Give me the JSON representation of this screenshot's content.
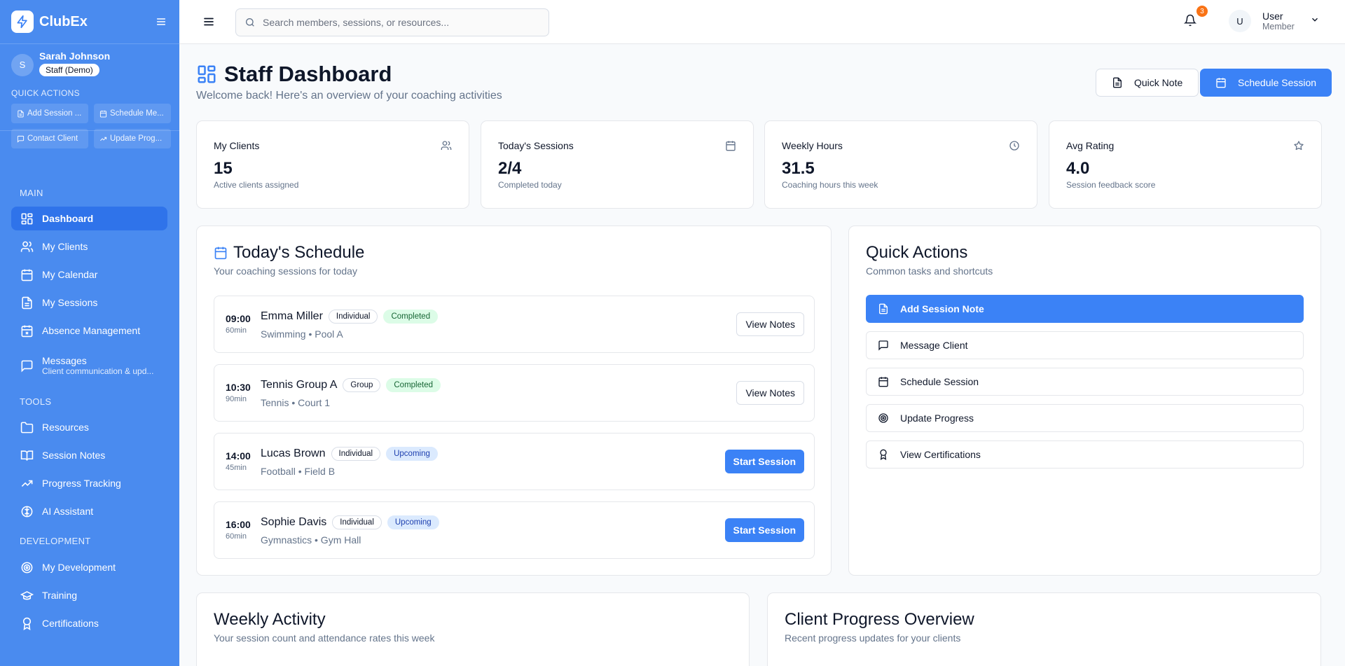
{
  "app": {
    "name": "ClubEx"
  },
  "sidebar": {
    "user": {
      "initial": "S",
      "name": "Sarah Johnson",
      "role": "Staff (Demo)"
    },
    "quick_actions_title": "QUICK ACTIONS",
    "quick_actions": [
      {
        "label": "Add Session ...",
        "icon": "note-icon"
      },
      {
        "label": "Schedule Me...",
        "icon": "calendar-icon"
      },
      {
        "label": "Contact Client",
        "icon": "message-icon"
      },
      {
        "label": "Update Prog...",
        "icon": "trend-icon"
      }
    ],
    "sections": {
      "main": "MAIN",
      "tools": "TOOLS",
      "development": "DEVELOPMENT"
    },
    "items": {
      "dashboard": "Dashboard",
      "my_clients": "My Clients",
      "my_calendar": "My Calendar",
      "my_sessions": "My Sessions",
      "absence_management": "Absence Management",
      "messages": "Messages",
      "messages_sub": "Client communication & upd...",
      "resources": "Resources",
      "session_notes": "Session Notes",
      "progress_tracking": "Progress Tracking",
      "ai_assistant": "AI Assistant",
      "my_development": "My Development",
      "training": "Training",
      "certifications": "Certifications"
    }
  },
  "topbar": {
    "search_placeholder": "Search members, sessions, or resources...",
    "notification_count": "3",
    "user": {
      "initial": "U",
      "name": "User",
      "role": "Member"
    }
  },
  "header": {
    "title": "Staff Dashboard",
    "subtitle": "Welcome back! Here's an overview of your coaching activities",
    "quick_note_label": "Quick Note",
    "schedule_session_label": "Schedule Session"
  },
  "stats": [
    {
      "label": "My Clients",
      "value": "15",
      "sub": "Active clients assigned",
      "icon": "users-icon"
    },
    {
      "label": "Today's Sessions",
      "value": "2/4",
      "sub": "Completed today",
      "icon": "calendar-icon"
    },
    {
      "label": "Weekly Hours",
      "value": "31.5",
      "sub": "Coaching hours this week",
      "icon": "clock-icon"
    },
    {
      "label": "Avg Rating",
      "value": "4.0",
      "sub": "Session feedback score",
      "icon": "star-icon"
    }
  ],
  "schedule": {
    "title": "Today's Schedule",
    "subtitle": "Your coaching sessions for today",
    "sessions": [
      {
        "time": "09:00",
        "duration": "60min",
        "name": "Emma Miller",
        "type": "Individual",
        "status": "Completed",
        "location": "Swimming • Pool A",
        "action": "View Notes"
      },
      {
        "time": "10:30",
        "duration": "90min",
        "name": "Tennis Group A",
        "type": "Group",
        "status": "Completed",
        "location": "Tennis • Court 1",
        "action": "View Notes"
      },
      {
        "time": "14:00",
        "duration": "45min",
        "name": "Lucas Brown",
        "type": "Individual",
        "status": "Upcoming",
        "location": "Football • Field B",
        "action": "Start Session"
      },
      {
        "time": "16:00",
        "duration": "60min",
        "name": "Sophie Davis",
        "type": "Individual",
        "status": "Upcoming",
        "location": "Gymnastics • Gym Hall",
        "action": "Start Session"
      }
    ]
  },
  "quick_actions_panel": {
    "title": "Quick Actions",
    "subtitle": "Common tasks and shortcuts",
    "actions": [
      {
        "label": "Add Session Note",
        "icon": "note-icon"
      },
      {
        "label": "Message Client",
        "icon": "message-icon"
      },
      {
        "label": "Schedule Session",
        "icon": "calendar-icon"
      },
      {
        "label": "Update Progress",
        "icon": "target-icon"
      },
      {
        "label": "View Certifications",
        "icon": "award-icon"
      }
    ]
  },
  "weekly_activity": {
    "title": "Weekly Activity",
    "subtitle": "Your session count and attendance rates this week"
  },
  "client_progress": {
    "title": "Client Progress Overview",
    "subtitle": "Recent progress updates for your clients"
  },
  "colors": {
    "sidebar": "#4a8bef",
    "accent": "#3b82f6",
    "completed": "#dcfce7",
    "upcoming": "#dbeafe",
    "badge": "#f97316"
  }
}
